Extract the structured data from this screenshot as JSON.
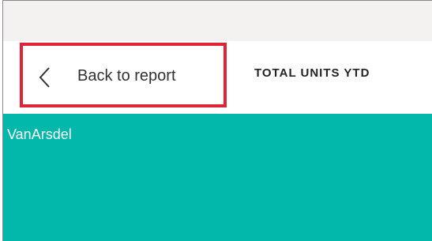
{
  "toolbar": {
    "back_label": "Back to report",
    "back_icon": "chevron-left-icon",
    "visual_title": "TOTAL UNITS YTD"
  },
  "tile": {
    "label": "VanArsdel"
  },
  "colors": {
    "highlight_border": "#e02438",
    "tile_fill": "#01b8aa",
    "toolbar_bg": "#ffffff",
    "canvas_bg": "#f3f2f1"
  }
}
